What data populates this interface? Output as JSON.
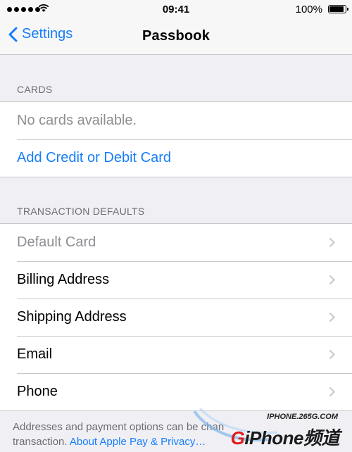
{
  "status_bar": {
    "time": "09:41",
    "battery_percent": "100%",
    "battery_level": 1.0,
    "signal_bars": 5
  },
  "nav": {
    "back_label": "Settings",
    "title": "Passbook"
  },
  "cards_section": {
    "header": "CARDS",
    "empty_text": "No cards available.",
    "add_label": "Add Credit or Debit Card"
  },
  "defaults_section": {
    "header": "TRANSACTION DEFAULTS",
    "items": [
      {
        "label": "Default Card",
        "enabled": false
      },
      {
        "label": "Billing Address",
        "enabled": true
      },
      {
        "label": "Shipping Address",
        "enabled": true
      },
      {
        "label": "Email",
        "enabled": true
      },
      {
        "label": "Phone",
        "enabled": true
      }
    ]
  },
  "footer": {
    "text_1": "Addresses and payment options can be chan",
    "text_2": "transaction.",
    "link": "About Apple Pay & Privacy…"
  },
  "watermark": {
    "url": "IPHONE.265G.COM",
    "logo_g": "G",
    "logo_rest": "iPhone频道"
  },
  "colors": {
    "accent": "#157efb",
    "background": "#efeff4",
    "disabled_text": "#8e8e93",
    "section_text": "#6d6d72"
  }
}
